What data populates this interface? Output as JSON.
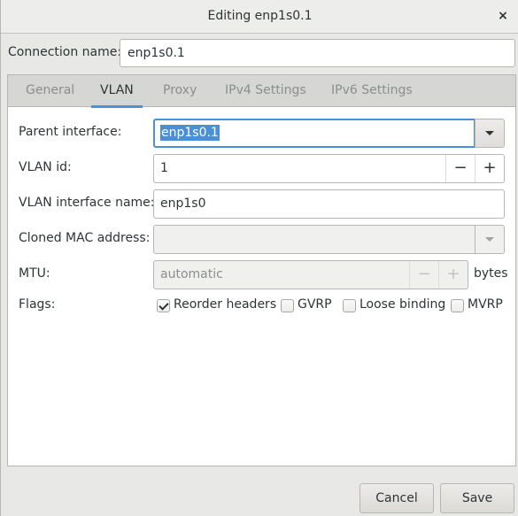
{
  "window": {
    "title": "Editing enp1s0.1",
    "close_icon": "×"
  },
  "connection_name": {
    "label": "Connection name:",
    "value": "enp1s0.1"
  },
  "tabs": [
    {
      "label": "General",
      "active": false
    },
    {
      "label": "VLAN",
      "active": true
    },
    {
      "label": "Proxy",
      "active": false
    },
    {
      "label": "IPv4 Settings",
      "active": false
    },
    {
      "label": "IPv6 Settings",
      "active": false
    }
  ],
  "vlan": {
    "parent_interface": {
      "label": "Parent interface:",
      "value": "enp1s0.1",
      "selected": true
    },
    "vlan_id": {
      "label": "VLAN id:",
      "value": "1",
      "minus": "−",
      "plus": "+"
    },
    "vlan_interface_name": {
      "label": "VLAN interface name:",
      "value": "enp1s0"
    },
    "cloned_mac": {
      "label": "Cloned MAC address:",
      "value": ""
    },
    "mtu": {
      "label": "MTU:",
      "value": "automatic",
      "unit": "bytes",
      "minus": "−",
      "plus": "+"
    },
    "flags": {
      "label": "Flags:",
      "items": [
        {
          "label": "Reorder headers",
          "checked": true
        },
        {
          "label": "GVRP",
          "checked": false
        },
        {
          "label": "Loose binding",
          "checked": false
        },
        {
          "label": "MVRP",
          "checked": false
        }
      ]
    }
  },
  "buttons": {
    "cancel": "Cancel",
    "save": "Save"
  }
}
